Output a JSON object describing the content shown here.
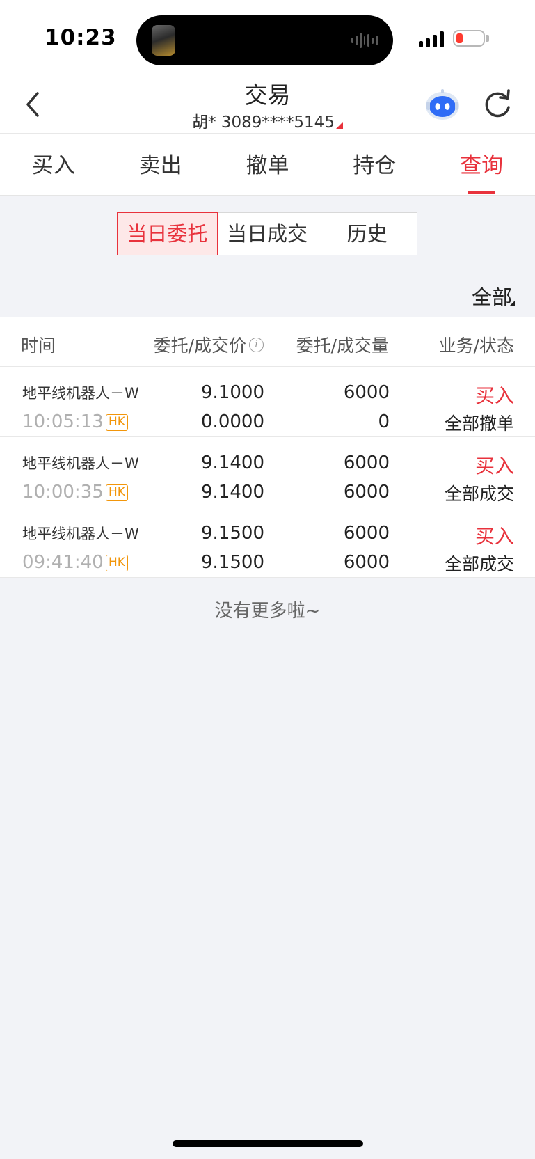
{
  "status_bar": {
    "time": "10:23"
  },
  "header": {
    "title": "交易",
    "account": "胡* 3089****5145"
  },
  "trade_tabs": [
    {
      "label": "买入"
    },
    {
      "label": "卖出"
    },
    {
      "label": "撤单"
    },
    {
      "label": "持仓"
    },
    {
      "label": "查询",
      "active": true
    }
  ],
  "segments": [
    {
      "label": "当日委托",
      "active": true
    },
    {
      "label": "当日成交"
    },
    {
      "label": "历史"
    }
  ],
  "filter": {
    "label": "全部"
  },
  "table": {
    "headers": {
      "time": "时间",
      "price": "委托/成交价",
      "qty": "委托/成交量",
      "status": "业务/状态"
    },
    "rows": [
      {
        "name": "地平线机器人－W",
        "time": "10:05:13",
        "market": "HK",
        "order_price": "9.1000",
        "fill_price": "0.0000",
        "order_qty": "6000",
        "fill_qty": "0",
        "side": "买入",
        "state": "全部撤单"
      },
      {
        "name": "地平线机器人－W",
        "time": "10:00:35",
        "market": "HK",
        "order_price": "9.1400",
        "fill_price": "9.1400",
        "order_qty": "6000",
        "fill_qty": "6000",
        "side": "买入",
        "state": "全部成交"
      },
      {
        "name": "地平线机器人－W",
        "time": "09:41:40",
        "market": "HK",
        "order_price": "9.1500",
        "fill_price": "9.1500",
        "order_qty": "6000",
        "fill_qty": "6000",
        "side": "买入",
        "state": "全部成交"
      }
    ]
  },
  "footer_note": "没有更多啦~",
  "colors": {
    "accent": "#e8323c",
    "hk_badge": "#f2960b",
    "background": "#f2f3f7"
  }
}
